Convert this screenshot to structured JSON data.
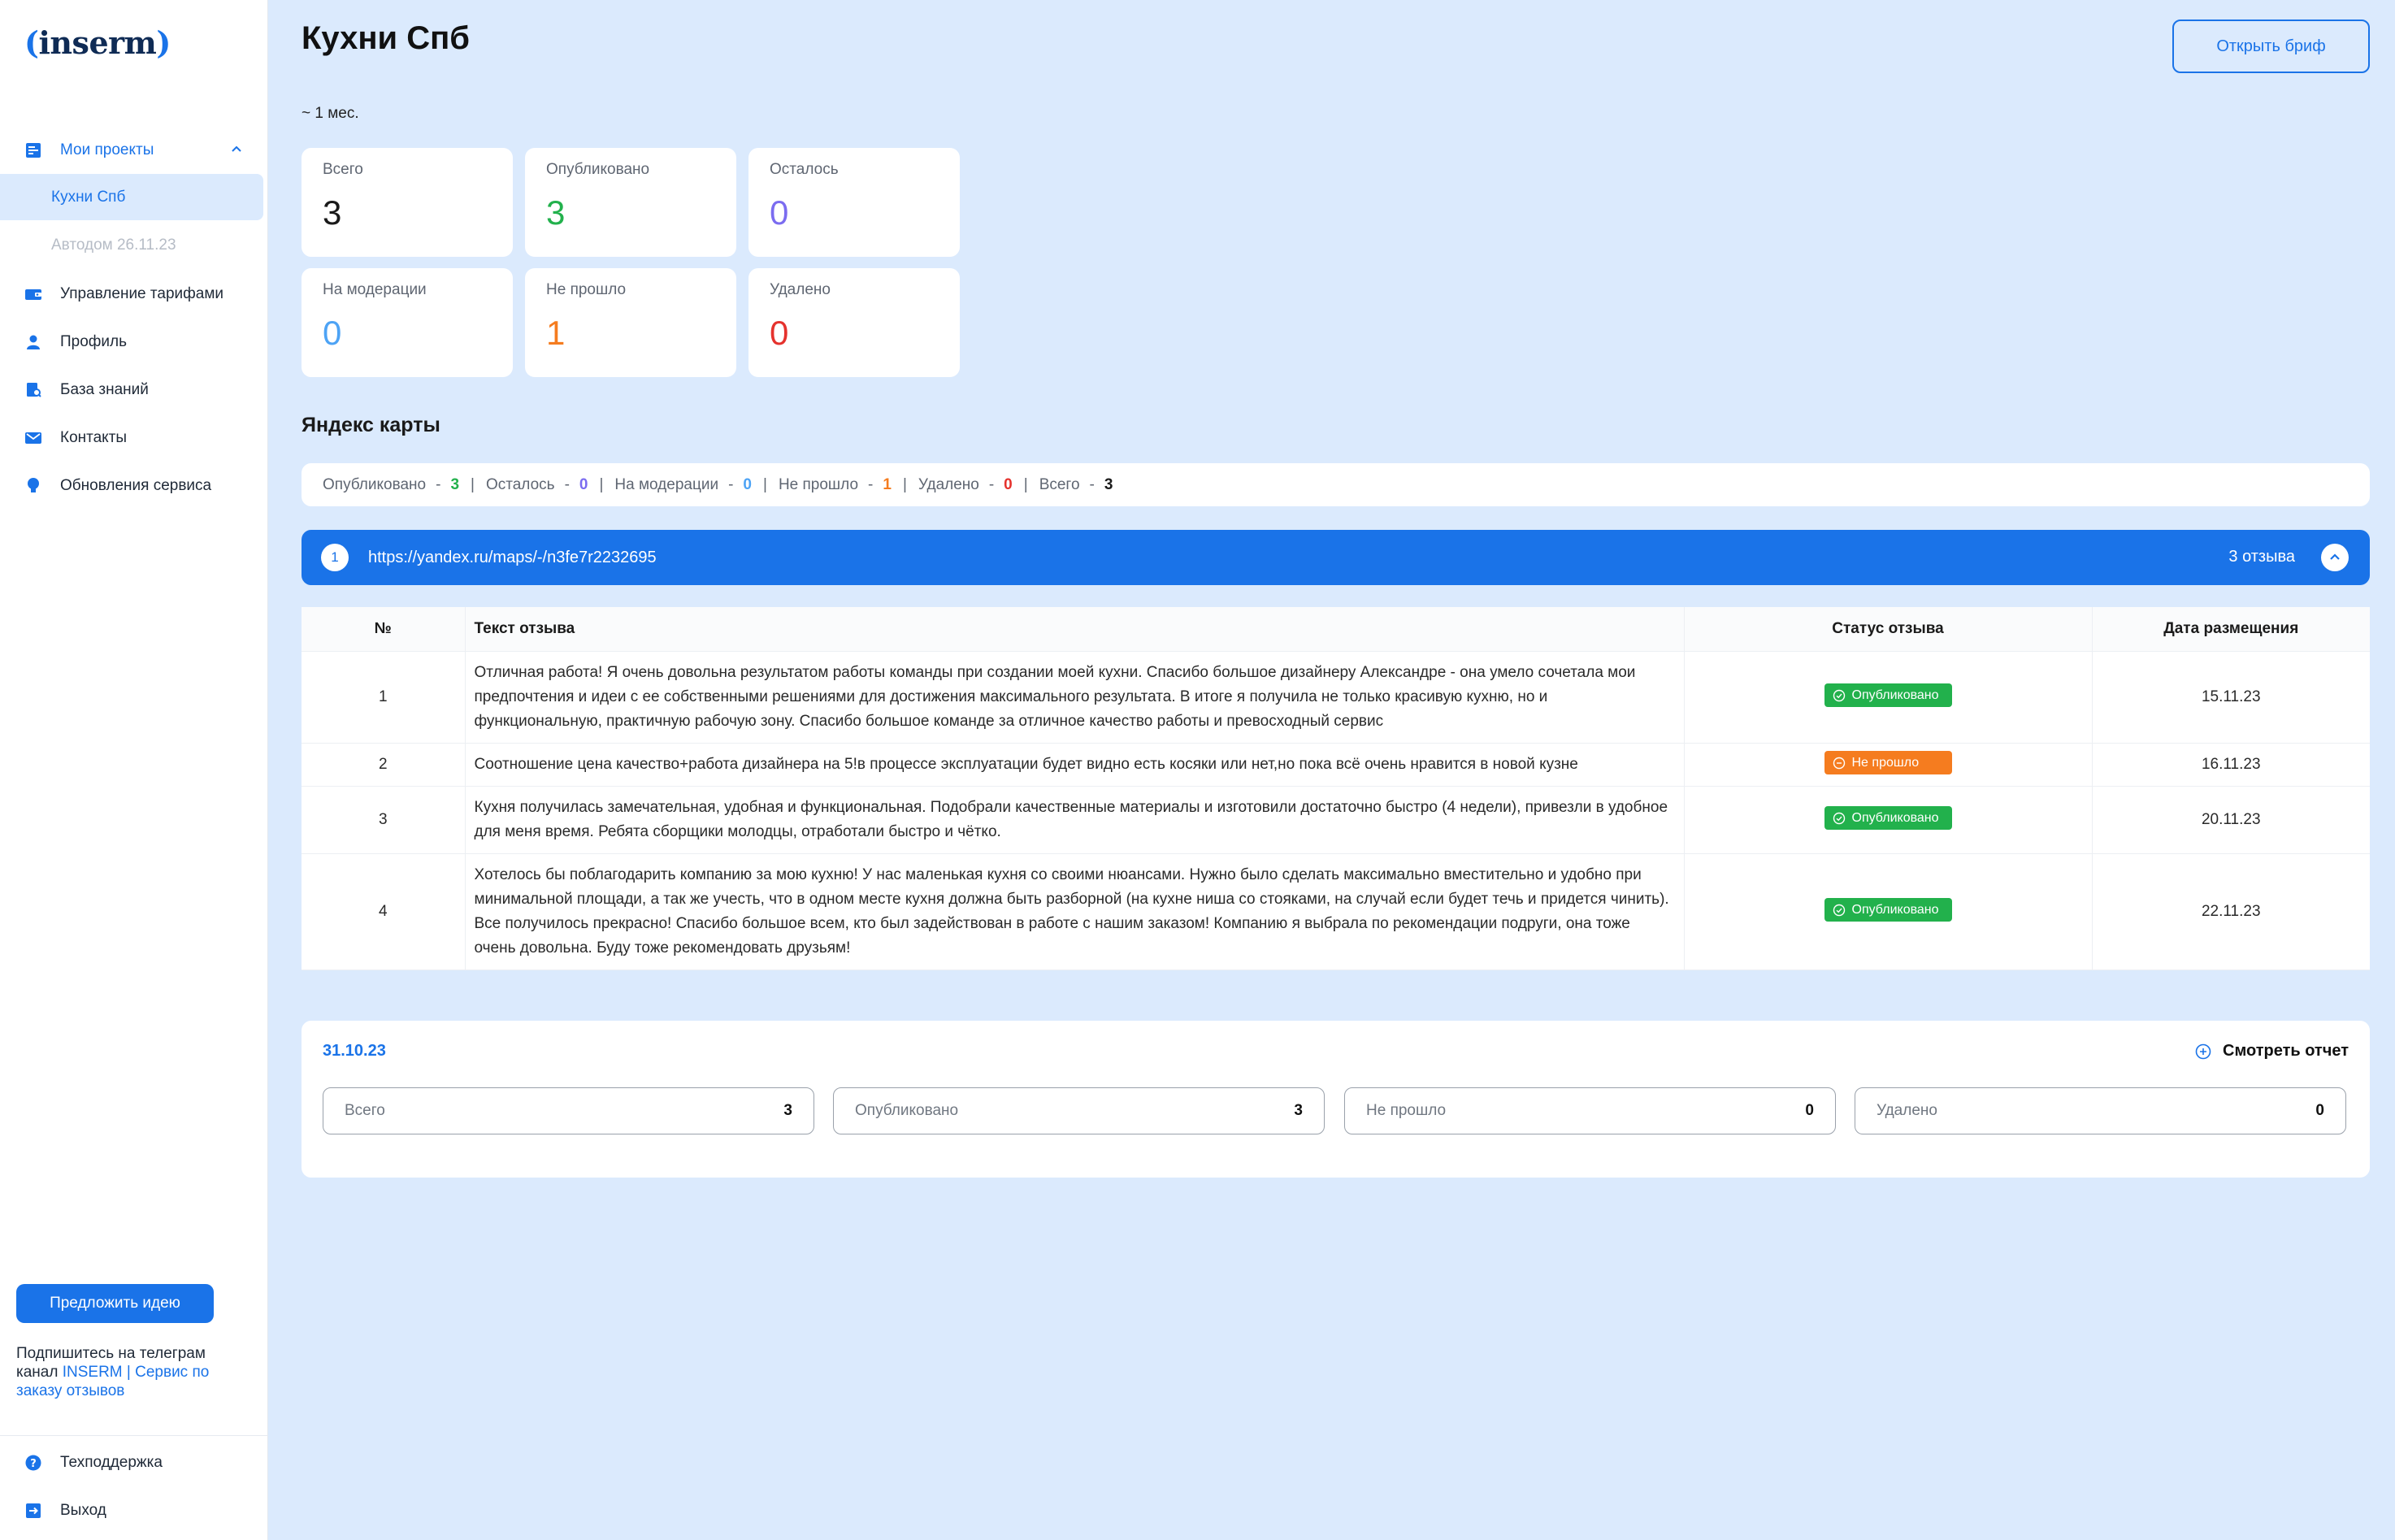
{
  "logo": {
    "open": "(",
    "name": "inserm",
    "close": ")"
  },
  "sidebar": {
    "projects_label": "Мои проекты",
    "sub_items": [
      {
        "label": "Кухни Спб",
        "state": "active"
      },
      {
        "label": "Автодом 26.11.23",
        "state": "muted"
      }
    ],
    "items": [
      {
        "label": "Управление тарифами",
        "icon": "wallet-icon"
      },
      {
        "label": "Профиль",
        "icon": "user-icon"
      },
      {
        "label": "База знаний",
        "icon": "knowledge-base-icon"
      },
      {
        "label": "Контакты",
        "icon": "mail-icon"
      },
      {
        "label": "Обновления сервиса",
        "icon": "lightbulb-icon"
      }
    ],
    "suggest_button": "Предложить идею",
    "subscribe": {
      "text": "Подпишитесь на телеграм канал ",
      "link": "INSERM | Сервис по заказу отзывов"
    },
    "bottom": [
      {
        "label": "Техподдержка",
        "icon": "help-icon"
      },
      {
        "label": "Выход",
        "icon": "logout-icon"
      }
    ]
  },
  "header": {
    "title": "Кухни Спб",
    "brief_button": "Открыть бриф",
    "period": "~ 1 мес."
  },
  "stats": [
    {
      "label": "Всего",
      "value": "3",
      "color": "#1a1a1a"
    },
    {
      "label": "Опубликовано",
      "value": "3",
      "color": "#22b14c"
    },
    {
      "label": "Осталось",
      "value": "0",
      "color": "#7b6cf0"
    },
    {
      "label": "На модерации",
      "value": "0",
      "color": "#4da3f5"
    },
    {
      "label": "Не прошло",
      "value": "1",
      "color": "#f57c1f"
    },
    {
      "label": "Удалено",
      "value": "0",
      "color": "#e5322d"
    }
  ],
  "platform": {
    "title": "Яндекс карты",
    "summary": [
      {
        "label": "Опубликовано",
        "value": "3",
        "color": "#22b14c"
      },
      {
        "label": "Осталось",
        "value": "0",
        "color": "#7b6cf0"
      },
      {
        "label": "На модерации",
        "value": "0",
        "color": "#4da3f5"
      },
      {
        "label": "Не прошло",
        "value": "1",
        "color": "#f57c1f"
      },
      {
        "label": "Удалено",
        "value": "0",
        "color": "#e5322d"
      },
      {
        "label": "Всего",
        "value": "3",
        "color": "#1a1a1a"
      }
    ],
    "link": {
      "index": "1",
      "url": "https://yandex.ru/maps/-/n3fe7r2232695",
      "count": "3 отзыва"
    },
    "table": {
      "headers": {
        "num": "№",
        "text": "Текст отзыва",
        "status": "Статус отзыва",
        "date": "Дата размещения"
      },
      "rows": [
        {
          "num": "1",
          "text": "Отличная работа! Я очень довольна результатом работы команды при создании моей кухни. Спасибо большое дизайнеру Александре - она умело сочетала мои предпочтения и идеи с ее собственными решениями для достижения максимального результата. В итоге я получила не только красивую кухню, но и функциональную, практичную рабочую зону. Спасибо большое команде за отличное качество работы и превосходный сервис",
          "status": "Опубликовано",
          "status_type": "ok",
          "date": "15.11.23"
        },
        {
          "num": "2",
          "text": "Соотношение цена качество+работа дизайнера на 5!в процессе эксплуатации будет видно есть косяки или нет,но пока всё очень нравится в новой кузне",
          "status": "Не прошло",
          "status_type": "fail",
          "date": "16.11.23"
        },
        {
          "num": "3",
          "text": "Кухня получилась замечательная, удобная и функциональная. Подобрали качественные материалы и изготовили достаточно быстро (4 недели), привезли в удобное для меня время. Ребята сборщики молодцы, отработали быстро и чётко.",
          "status": "Опубликовано",
          "status_type": "ok",
          "date": "20.11.23"
        },
        {
          "num": "4",
          "text": "Хотелось бы поблагодарить компанию за мою кухню! У нас маленькая кухня со своими нюансами. Нужно было сделать максимально вместительно и удобно при минимальной площади, а так же учесть, что в одном месте кухня должна быть разборной (на кухне ниша со стояками, на случай если будет течь и придется чинить). Все получилось прекрасно! Спасибо большое всем, кто был задействован в работе с нашим заказом! Компанию я выбрала по рекомендации подруги, она тоже очень довольна. Буду тоже рекомендовать друзьям!",
          "status": "Опубликовано",
          "status_type": "ok",
          "date": "22.11.23"
        }
      ]
    }
  },
  "report": {
    "date": "31.10.23",
    "view_label": "Смотреть отчет",
    "boxes": [
      {
        "label": "Всего",
        "value": "3"
      },
      {
        "label": "Опубликовано",
        "value": "3"
      },
      {
        "label": "Не прошло",
        "value": "0"
      },
      {
        "label": "Удалено",
        "value": "0"
      }
    ]
  }
}
